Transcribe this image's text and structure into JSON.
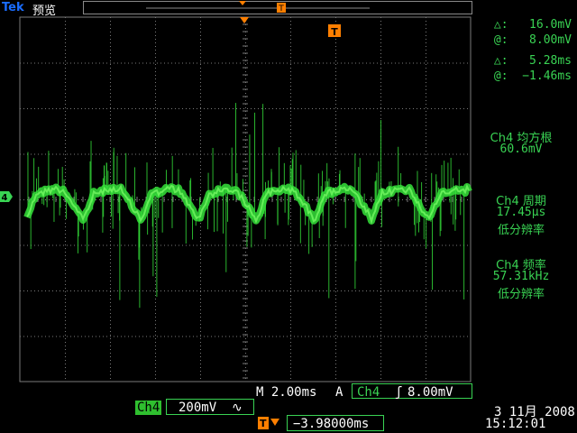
{
  "header": {
    "brand": "Tek",
    "mode_label": "预览",
    "trigger_marker": "T"
  },
  "cursor_readouts": {
    "v_delta": "△:   16.0mV",
    "v_at": "@:   8.00mV",
    "t_delta": "△:   5.28ms",
    "t_at": "@:  −1.46ms"
  },
  "measurements": [
    {
      "title": "Ch4 均方根",
      "value": "60.6mV",
      "note": ""
    },
    {
      "title": "Ch4 周期",
      "value": "17.45µs",
      "note": "低分辨率"
    },
    {
      "title": "Ch4 频率",
      "value": "57.31kHz",
      "note": "低分辨率"
    }
  ],
  "status": {
    "timebase": "M 2.00ms",
    "trigger_mode": "A",
    "trigger_channel": "Ch4",
    "trigger_slope_icon": "rising-edge-icon",
    "trigger_level": "8.00mV",
    "ch_label": "Ch4",
    "ch_scale": "200mV",
    "ch_coupling_icon": "ac-coupling-icon",
    "trigger_position": "−3.98000ms",
    "date": "3 11月 2008",
    "time": "15:12:01"
  },
  "colors": {
    "trace": "#35e23a",
    "grid": "#7a7a7a",
    "accent_orange": "#ff7f00",
    "brand_blue": "#1a6dff"
  }
}
